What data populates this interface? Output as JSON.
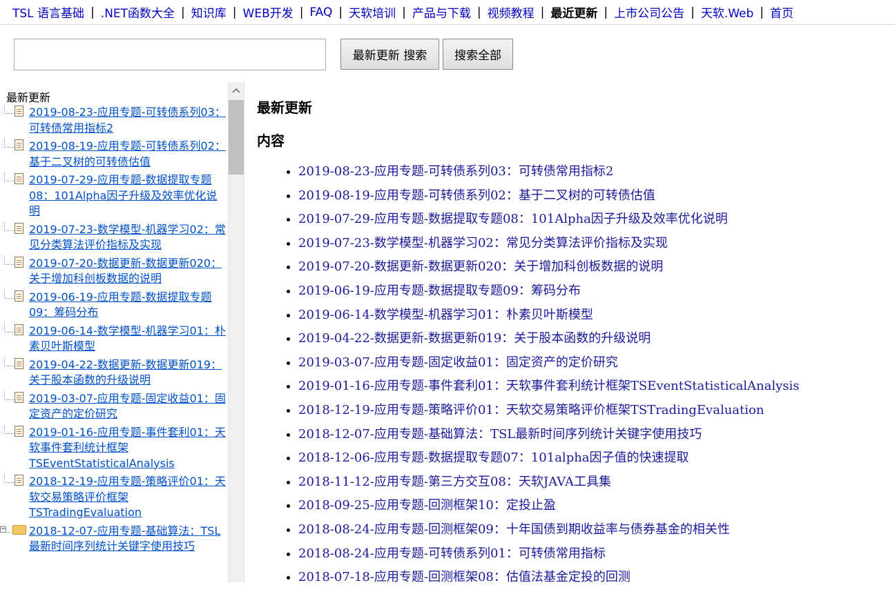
{
  "nav": {
    "items": [
      {
        "label": "TSL 语言基础"
      },
      {
        "label": ".NET函数大全"
      },
      {
        "label": "知识库"
      },
      {
        "label": "WEB开发"
      },
      {
        "label": "FAQ"
      },
      {
        "label": "天软培训"
      },
      {
        "label": "产品与下载"
      },
      {
        "label": "视频教程"
      },
      {
        "label": "最近更新",
        "active": true
      },
      {
        "label": "上市公司公告"
      },
      {
        "label": "天软.Web"
      },
      {
        "label": "首页"
      }
    ],
    "separator": "|"
  },
  "search": {
    "value": "",
    "placeholder": "",
    "recent_button": "最新更新 搜索",
    "all_button": "搜索全部"
  },
  "tree": {
    "root_label": "最新更新",
    "items": [
      {
        "label": "2019-08-23-应用专题-可转债系列03：可转债常用指标2",
        "icon": "document-icon"
      },
      {
        "label": "2019-08-19-应用专题-可转债系列02：基于二叉树的可转债估值",
        "icon": "document-icon"
      },
      {
        "label": "2019-07-29-应用专题-数据提取专题08：101Alpha因子升级及效率优化说明",
        "icon": "document-icon"
      },
      {
        "label": "2019-07-23-数学模型-机器学习02：常见分类算法评价指标及实现",
        "icon": "document-icon"
      },
      {
        "label": "2019-07-20-数据更新-数据更新020：关于增加科创板数据的说明",
        "icon": "document-icon"
      },
      {
        "label": "2019-06-19-应用专题-数据提取专题09：筹码分布",
        "icon": "document-icon"
      },
      {
        "label": "2019-06-14-数学模型-机器学习01：朴素贝叶斯模型",
        "icon": "document-icon"
      },
      {
        "label": "2019-04-22-数据更新-数据更新019：关于股本函数的升级说明",
        "icon": "document-icon"
      },
      {
        "label": "2019-03-07-应用专题-固定收益01：固定资产的定价研究",
        "icon": "document-icon"
      },
      {
        "label": "2019-01-16-应用专题-事件套利01：天软事件套利统计框架TSEventStatisticalAnalysis",
        "icon": "document-icon"
      },
      {
        "label": "2018-12-19-应用专题-策略评价01：天软交易策略评价框架TSTradingEvaluation",
        "icon": "document-icon"
      },
      {
        "label": "2018-12-07-应用专题-基础算法：TSL最新时间序列统计关键字使用技巧",
        "icon": "folder-open-icon",
        "expanded": true
      }
    ]
  },
  "main": {
    "title": "最新更新",
    "section_title": "内容",
    "items": [
      "2019-08-23-应用专题-可转债系列03：可转债常用指标2",
      "2019-08-19-应用专题-可转债系列02：基于二叉树的可转债估值",
      "2019-07-29-应用专题-数据提取专题08：101Alpha因子升级及效率优化说明",
      "2019-07-23-数学模型-机器学习02：常见分类算法评价指标及实现",
      "2019-07-20-数据更新-数据更新020：关于增加科创板数据的说明",
      "2019-06-19-应用专题-数据提取专题09：筹码分布",
      "2019-06-14-数学模型-机器学习01：朴素贝叶斯模型",
      "2019-04-22-数据更新-数据更新019：关于股本函数的升级说明",
      "2019-03-07-应用专题-固定收益01：固定资产的定价研究",
      "2019-01-16-应用专题-事件套利01：天软事件套利统计框架TSEventStatisticalAnalysis",
      "2018-12-19-应用专题-策略评价01：天软交易策略评价框架TSTradingEvaluation",
      "2018-12-07-应用专题-基础算法：TSL最新时间序列统计关键字使用技巧",
      "2018-12-06-应用专题-数据提取专题07：101alpha因子值的快速提取",
      "2018-11-12-应用专题-第三方交互08：天软JAVA工具集",
      "2018-09-25-应用专题-回测框架10：定投止盈",
      "2018-08-24-应用专题-回测框架09：十年国债到期收益率与债券基金的相关性",
      "2018-08-24-应用专题-可转债系列01：可转债常用指标",
      "2018-07-18-应用专题-回测框架08：估值法基金定投的回测"
    ]
  },
  "colors": {
    "nav_link": "#0000c0",
    "tree_link": "#0050c8",
    "content_link": "#1a1a9a",
    "scroll_thumb": "#c1c1c1"
  }
}
